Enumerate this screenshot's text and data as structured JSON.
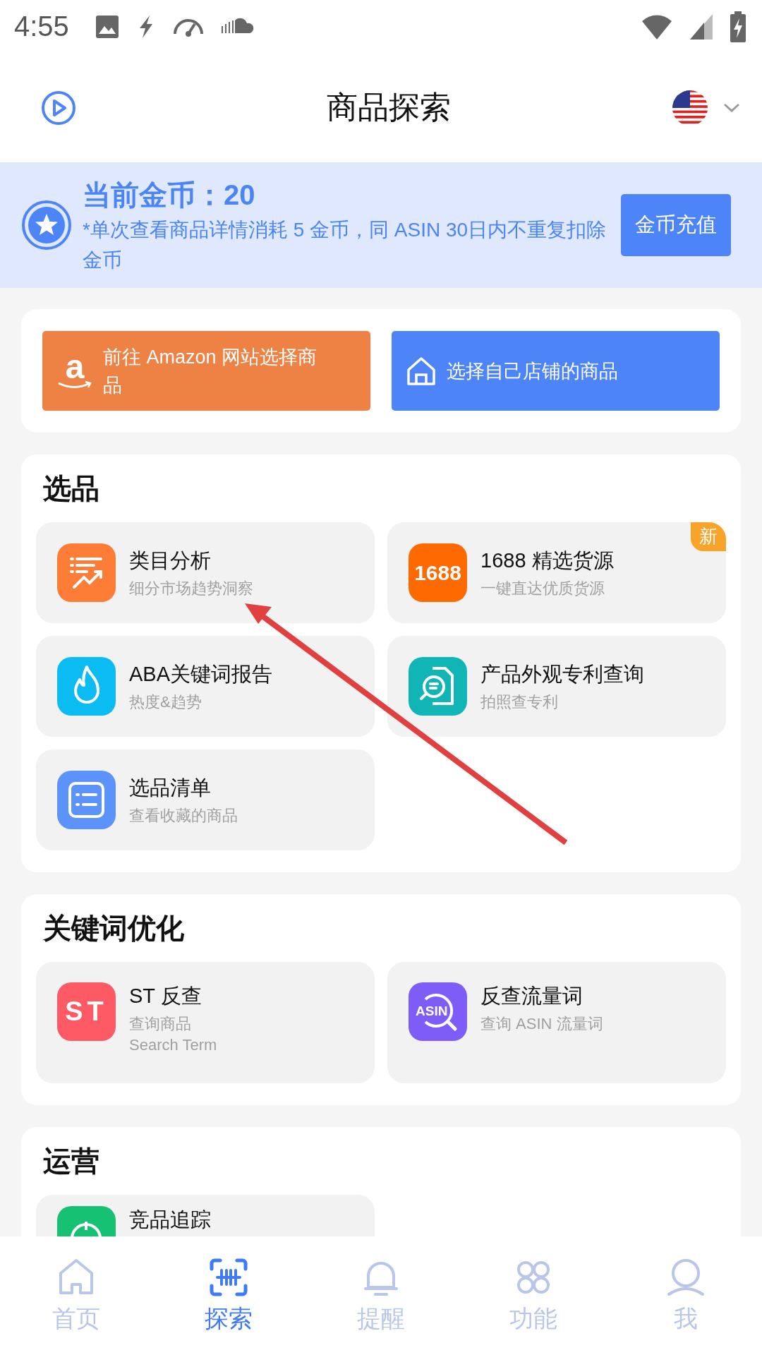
{
  "status_bar": {
    "time": "4:55"
  },
  "header": {
    "title": "商品探索"
  },
  "coins": {
    "title": "当前金币：20",
    "note": "*单次查看商品详情消耗 5 金币，同 ASIN 30日内不重复扣除金币",
    "button": "金币充值"
  },
  "source_buttons": [
    {
      "kind": "amazon",
      "logo": "a",
      "label": "前往 Amazon 网站选择商品"
    },
    {
      "kind": "store",
      "label": "选择自己店铺的商品"
    }
  ],
  "sections": [
    {
      "title": "选品",
      "tools": [
        {
          "kind": "chart",
          "title": "类目分析",
          "subtitle": "细分市场趋势洞察"
        },
        {
          "kind": "logo1688",
          "logo": "1688",
          "title": "1688 精选货源",
          "subtitle": "一键直达优质货源",
          "badge": "新"
        },
        {
          "kind": "fire",
          "title": "ABA关键词报告",
          "subtitle": "热度&趋势"
        },
        {
          "kind": "patent",
          "title": "产品外观专利查询",
          "subtitle": "拍照查专利"
        },
        {
          "kind": "list",
          "title": "选品清单",
          "subtitle": "查看收藏的商品"
        }
      ]
    },
    {
      "title": "关键词优化",
      "tools": [
        {
          "kind": "st",
          "logo": "ST",
          "title": "ST 反查",
          "subtitle": "查询商品\nSearch Term"
        },
        {
          "kind": "asin",
          "logo": "ASIN",
          "title": "反查流量词",
          "subtitle": "查询 ASIN 流量词"
        }
      ]
    },
    {
      "title": "运营",
      "tools": [
        {
          "kind": "target",
          "title": "竞品追踪"
        }
      ]
    }
  ],
  "bottom_nav": [
    {
      "kind": "home",
      "label": "首页",
      "selected": false
    },
    {
      "kind": "scan",
      "label": "探索",
      "selected": true
    },
    {
      "kind": "bell",
      "label": "提醒",
      "selected": false
    },
    {
      "kind": "apps",
      "label": "功能",
      "selected": false
    },
    {
      "kind": "user",
      "label": "我",
      "selected": false
    }
  ]
}
